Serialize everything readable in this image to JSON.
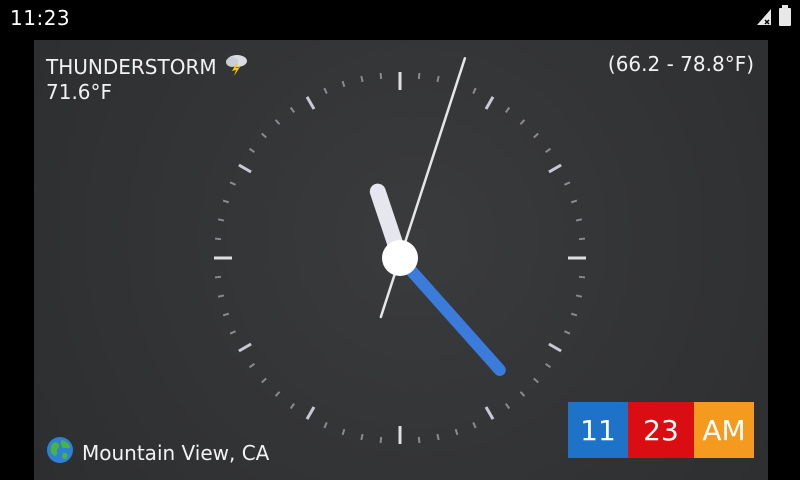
{
  "status_bar": {
    "time": "11:23",
    "icons": [
      "signal-icon",
      "battery-icon"
    ]
  },
  "weather": {
    "condition": "THUNDERSTORM",
    "condition_icon": "thunderstorm-icon",
    "temperature": "71.6°F",
    "range": "(66.2 - 78.8°F)"
  },
  "location": {
    "icon": "globe-icon",
    "name": "Mountain View, CA"
  },
  "clock": {
    "hour": 11,
    "minute": 23,
    "second": 3
  },
  "digital": {
    "hour": "11",
    "minute": "23",
    "ampm": "AM"
  },
  "colors": {
    "hour_bg": "#1e73c8",
    "minute_bg": "#d90d12",
    "ampm_bg": "#f39a1f",
    "minute_hand": "#3b7bdc",
    "hour_hand": "#e6e6ee"
  }
}
